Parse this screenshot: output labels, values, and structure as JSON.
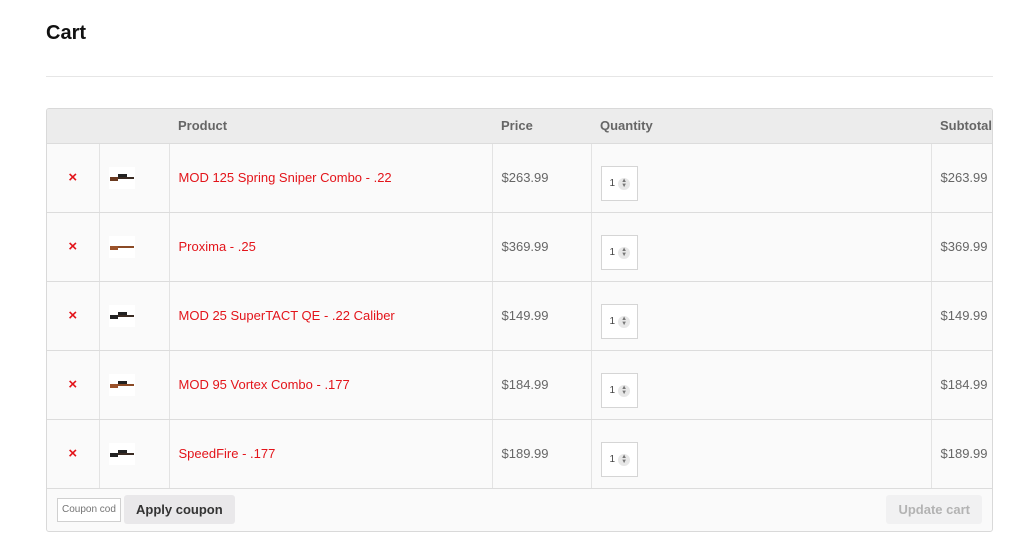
{
  "page": {
    "title": "Cart"
  },
  "table": {
    "headers": {
      "product": "Product",
      "price": "Price",
      "quantity": "Quantity",
      "subtotal": "Subtotal"
    },
    "items": [
      {
        "remove": "×",
        "name": "MOD 125 Spring Sniper Combo - .22",
        "price": "$263.99",
        "quantity": "1",
        "subtotal": "$263.99",
        "thumb": "rifle-scope-icon"
      },
      {
        "remove": "×",
        "name": "Proxima - .25",
        "price": "$369.99",
        "quantity": "1",
        "subtotal": "$369.99",
        "thumb": "wood-rifle-icon"
      },
      {
        "remove": "×",
        "name": "MOD 25 SuperTACT QE - .22 Caliber",
        "price": "$149.99",
        "quantity": "1",
        "subtotal": "$149.99",
        "thumb": "tactical-rifle-icon"
      },
      {
        "remove": "×",
        "name": "MOD 95 Vortex Combo - .177",
        "price": "$184.99",
        "quantity": "1",
        "subtotal": "$184.99",
        "thumb": "rifle-scope-icon"
      },
      {
        "remove": "×",
        "name": "SpeedFire - .177",
        "price": "$189.99",
        "quantity": "1",
        "subtotal": "$189.99",
        "thumb": "black-rifle-icon"
      }
    ]
  },
  "coupon": {
    "placeholder": "Coupon code",
    "apply_label": "Apply coupon"
  },
  "update_label": "Update cart",
  "colors": {
    "accent": "#e3141a",
    "header_bg": "#ececec",
    "button_bg": "#e9e8ea"
  }
}
